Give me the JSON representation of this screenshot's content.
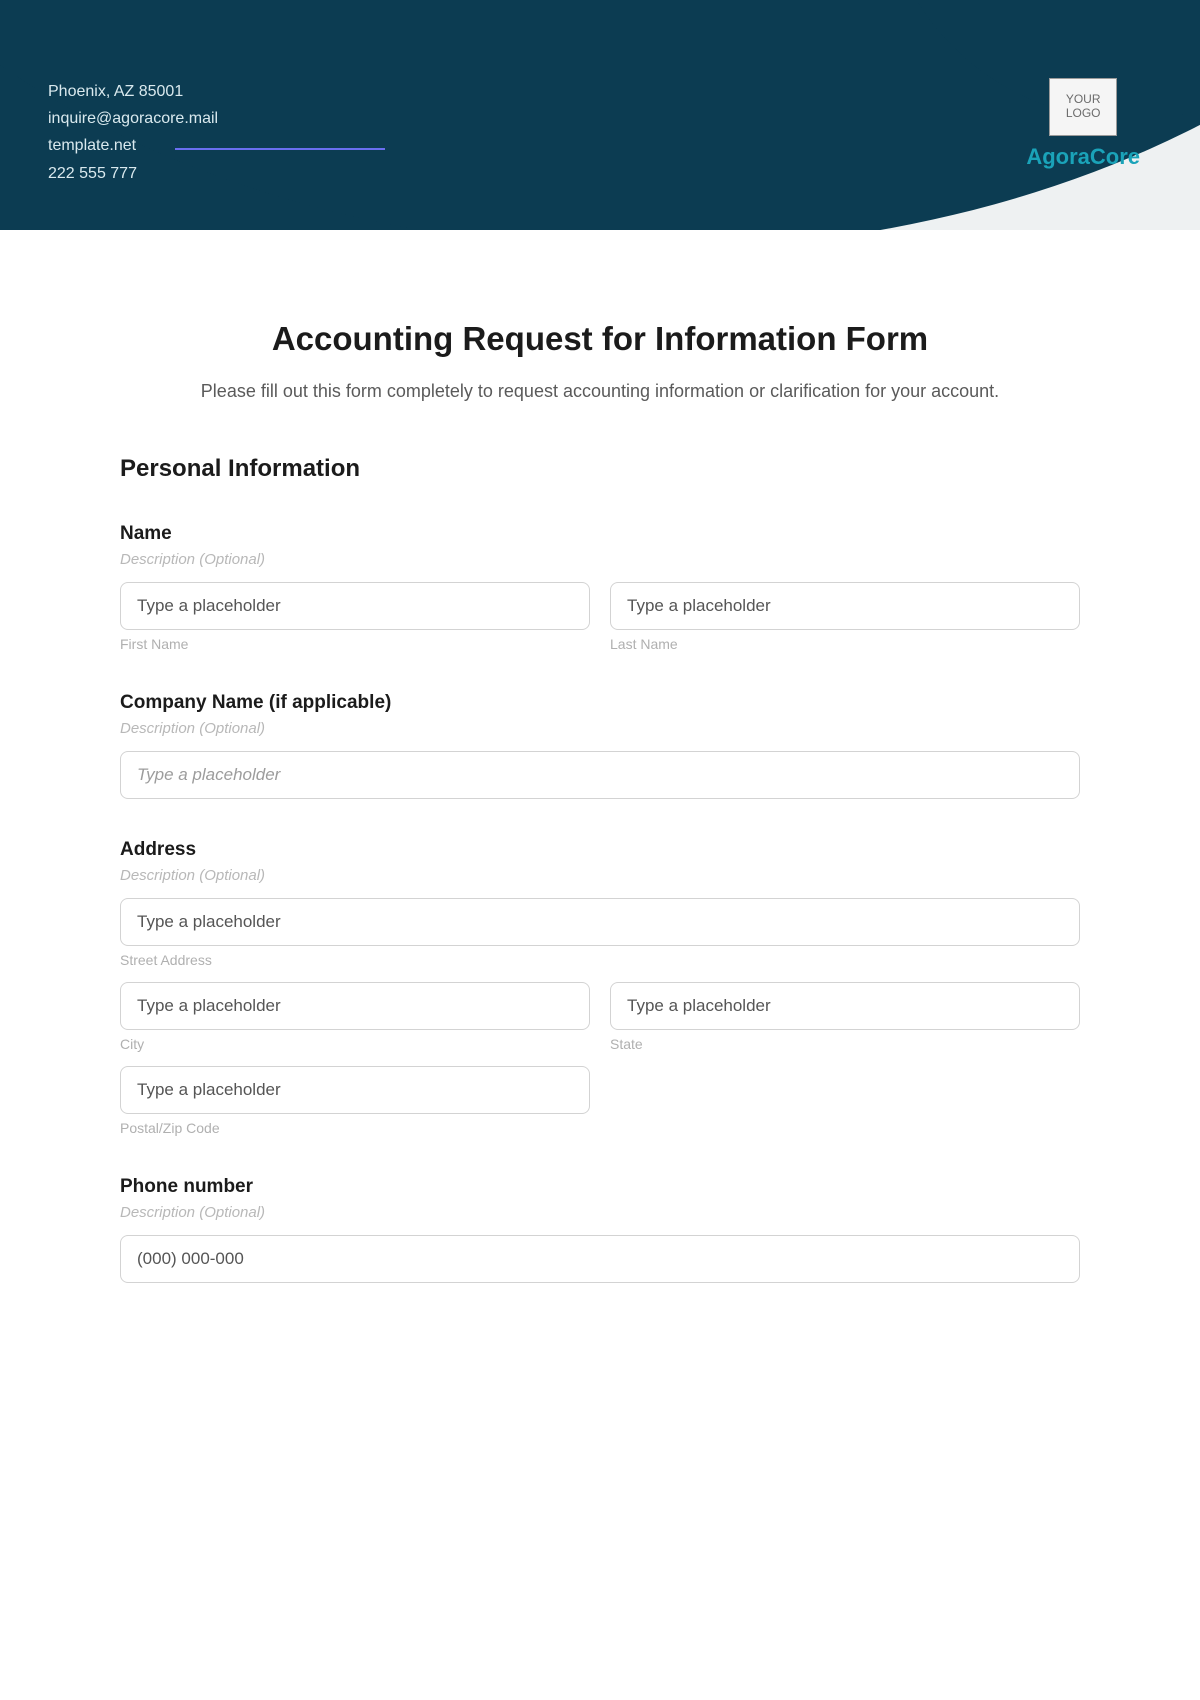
{
  "header": {
    "contact": {
      "address": "Phoenix, AZ 85001",
      "email": "inquire@agoracore.mail",
      "website": "template.net",
      "phone": "222 555 777"
    },
    "logo_text": "YOUR\nLOGO",
    "brand_name": "AgoraCore"
  },
  "form": {
    "title": "Accounting Request for Information Form",
    "intro": "Please fill out this form completely to request accounting information or clarification for your account.",
    "section_personal": "Personal Information",
    "name": {
      "label": "Name",
      "desc": "Description (Optional)",
      "first_placeholder": "Type a placeholder",
      "first_sub": "First Name",
      "last_placeholder": "Type a placeholder",
      "last_sub": "Last Name"
    },
    "company": {
      "label": "Company Name (if applicable)",
      "desc": "Description (Optional)",
      "placeholder": "Type a placeholder"
    },
    "address": {
      "label": "Address",
      "desc": "Description (Optional)",
      "street_placeholder": "Type a placeholder",
      "street_sub": "Street Address",
      "city_placeholder": "Type a placeholder",
      "city_sub": "City",
      "state_placeholder": "Type a placeholder",
      "state_sub": "State",
      "zip_placeholder": "Type a placeholder",
      "zip_sub": "Postal/Zip Code"
    },
    "phone": {
      "label": "Phone number",
      "desc": "Description (Optional)",
      "placeholder": "(000) 000-000"
    }
  }
}
